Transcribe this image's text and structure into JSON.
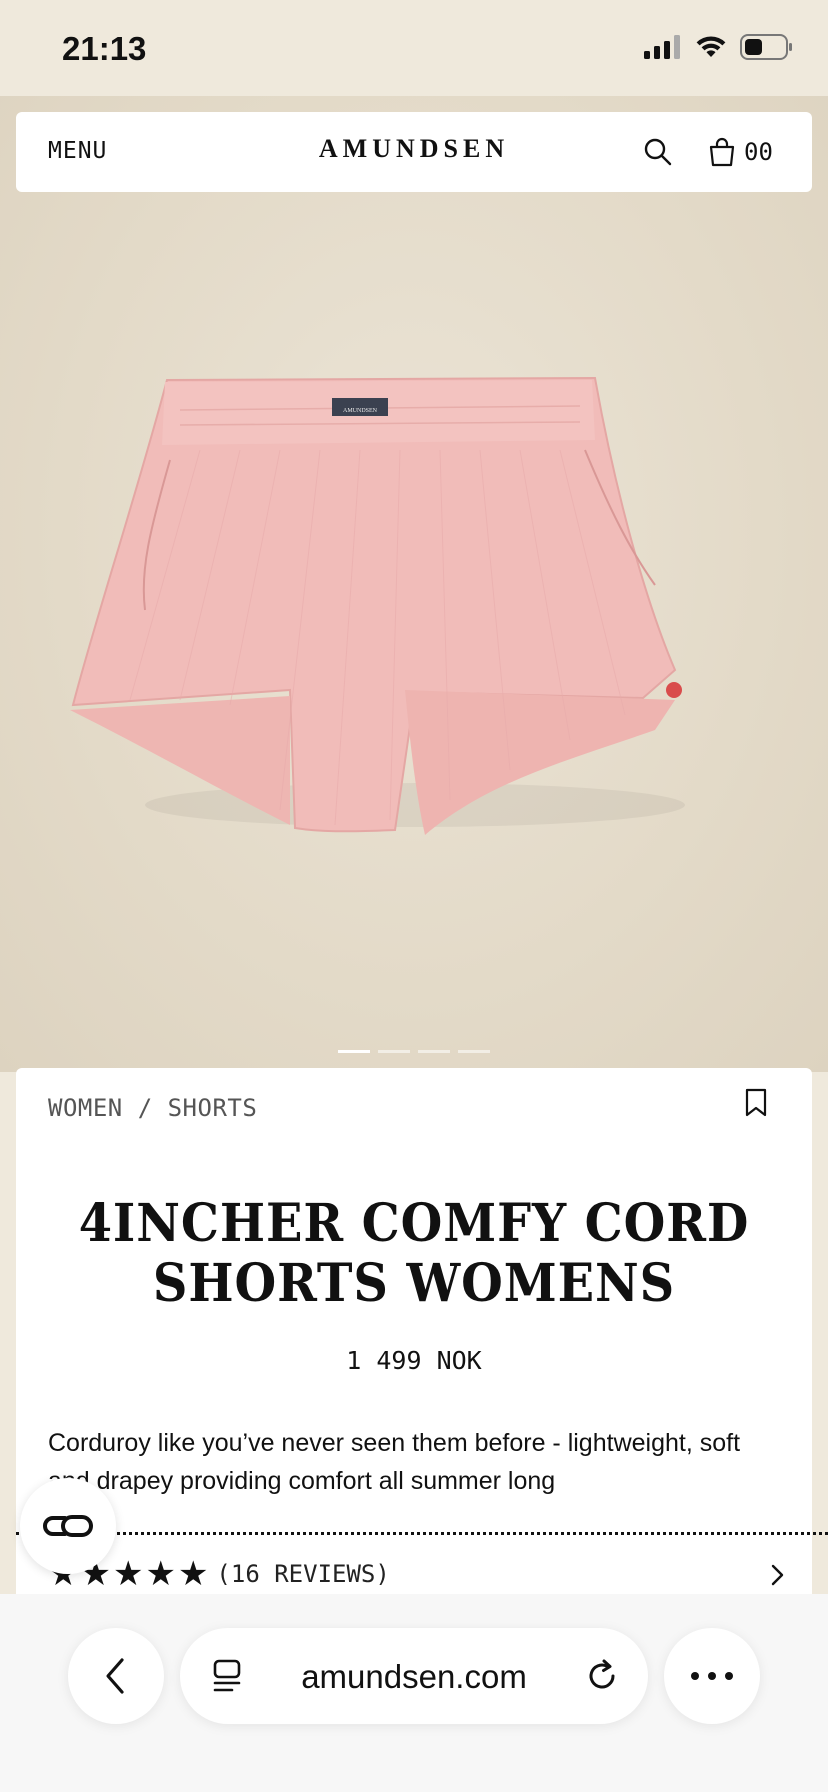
{
  "status_bar": {
    "time": "21:13"
  },
  "header": {
    "menu_label": "MENU",
    "brand": "AMUNDSEN",
    "cart_count": "00"
  },
  "product": {
    "image_label": "AMUNDSEN",
    "breadcrumb": "WOMEN / SHORTS",
    "title_line1": "4INCHER COMFY CORD",
    "title_line2": "SHORTS WOMENS",
    "price": "1 499 NOK",
    "description": "Corduroy like you’ve never seen them before - lightweight, soft and drapey providing comfort all summer long",
    "rating_stars": 5,
    "reviews_label": "(16 REVIEWS)",
    "color_hex": "#f1bcb9"
  },
  "carousel": {
    "total": 4,
    "active_index": 0
  },
  "browser": {
    "url": "amundsen.com"
  },
  "icons": {
    "search": "search-icon",
    "cart": "shopping-bag-icon",
    "bookmark": "bookmark-icon",
    "chevron": "chevron-right-icon",
    "chat": "chat-icon",
    "back": "chevron-left-icon",
    "tabs": "tabs-icon",
    "reload": "reload-icon",
    "more": "more-icon"
  },
  "colors": {
    "background": "#efe9dc",
    "hero_bg": "#e3dac8",
    "text": "#111111"
  }
}
